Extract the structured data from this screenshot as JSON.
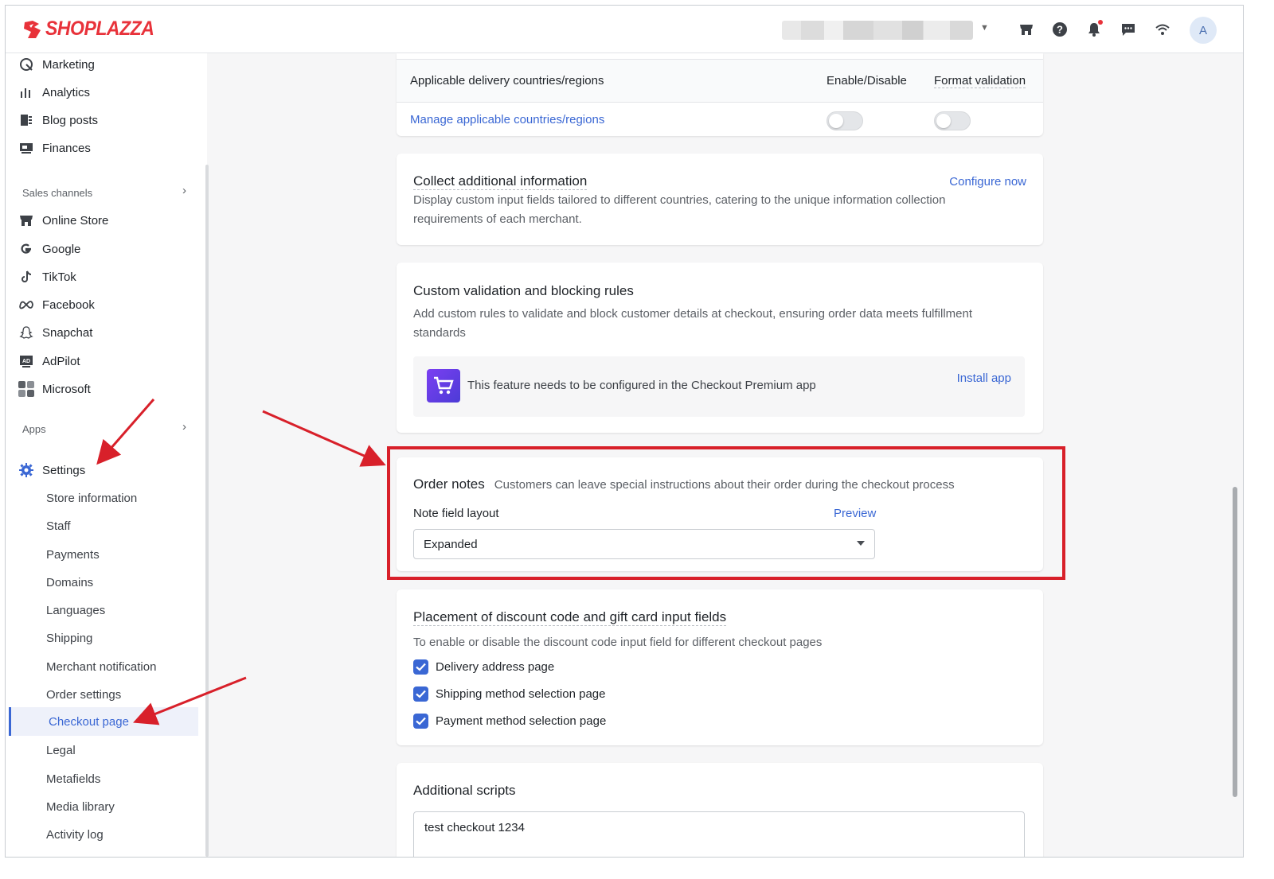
{
  "brand": {
    "name": "SHOPLAZZA",
    "accent": "#e8323a",
    "link_color": "#3a67d4"
  },
  "header": {
    "avatar_initial": "A"
  },
  "sidebar": {
    "top_items": [
      "Marketing",
      "Analytics",
      "Blog posts",
      "Finances"
    ],
    "sales_channels_label": "Sales channels",
    "channels": [
      "Online Store",
      "Google",
      "TikTok",
      "Facebook",
      "Snapchat",
      "AdPilot",
      "Microsoft"
    ],
    "apps_label": "Apps",
    "settings_label": "Settings",
    "settings_items": [
      "Store information",
      "Staff",
      "Payments",
      "Domains",
      "Languages",
      "Shipping",
      "Merchant notification",
      "Order settings",
      "Checkout page",
      "Legal",
      "Metafields",
      "Media library",
      "Activity log"
    ],
    "active_item": "Checkout page"
  },
  "delivery_table": {
    "col_region": "Applicable delivery countries/regions",
    "col_enable": "Enable/Disable",
    "col_format": "Format validation",
    "manage_link": "Manage applicable countries/regions"
  },
  "collect_info": {
    "title": "Collect additional information",
    "action": "Configure now",
    "description": "Display custom input fields tailored to different countries, catering to the unique information collection requirements of each merchant."
  },
  "custom_validation": {
    "title": "Custom validation and blocking rules",
    "description": "Add custom rules to validate and block customer details at checkout, ensuring order data meets fulfillment standards",
    "app_notice": "This feature needs to be configured in the Checkout Premium app",
    "install_link": "Install app"
  },
  "order_notes": {
    "title": "Order notes",
    "subtitle": "Customers can leave special instructions about their order during the checkout process",
    "field_label": "Note field layout",
    "preview_link": "Preview",
    "selected_layout": "Expanded"
  },
  "discount_placement": {
    "title": "Placement of discount code and gift card input fields",
    "description": "To enable or disable the discount code input field for different checkout pages",
    "options": [
      {
        "label": "Delivery address page",
        "checked": true
      },
      {
        "label": "Shipping method selection page",
        "checked": true
      },
      {
        "label": "Payment method selection page",
        "checked": true
      }
    ]
  },
  "additional_scripts": {
    "title": "Additional scripts",
    "value": "test checkout 1234"
  }
}
